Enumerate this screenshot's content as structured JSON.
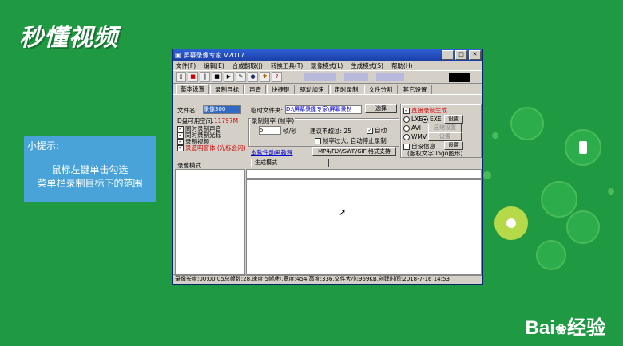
{
  "brand": {
    "logo": "秒懂视频",
    "footer_logo": "Bai",
    "footer_tail": "经验"
  },
  "tip": {
    "title": "小提示:",
    "line1": "鼠标左键单击勾选",
    "line2": "菜单栏录制目标下的范围"
  },
  "window": {
    "title": "屏幕录像专家 V2017",
    "menu": [
      "文件(F)",
      "编辑(E)",
      "合成翻取(J)",
      "转换工具(T)",
      "录像模式(L)",
      "生成模式(S)",
      "帮助(H)"
    ],
    "tabs": [
      "基本设置",
      "录制目标",
      "声音",
      "快捷键",
      "驱动加速",
      "定时录制",
      "文件分割",
      "其它设置"
    ],
    "basic": {
      "filename_label": "文件名:",
      "filename_value": "录像300",
      "disk_free_label": "D盘可用空间:",
      "disk_free_value": "11797M",
      "checks": [
        "同时录制声音",
        "同时录制光标",
        "录制视频",
        "录造明窗体 (光标会闪)"
      ],
      "temp_folder_label": "临时文件夹:",
      "temp_folder_value": "D:\\屏幕录像专家\\屏幕录制",
      "choose_button": "选择",
      "fps_group": "录制频率 (帧率)",
      "fps_value": "5",
      "fps_unit": "帧/秒",
      "advice_label": "建议不超过: 25",
      "auto_label": "自动",
      "frame_too_big": "帧率过大, 自动停止录制",
      "tutorial_link": "本软件动画教程",
      "format_label": "MP4/FLV/SWF/GIF  格式支持",
      "direct_gen": "直接录制生成",
      "lxe_label": "LXE",
      "exe_label": "EXE",
      "settings_btn": "设置",
      "avi_label": "AVI",
      "compress_btn": "压缩设置",
      "wmv_label": "WMV",
      "settings_btn2": "设置",
      "auto_info": "自设信息",
      "settings_btn3": "设置",
      "copyright_text": "(版权文字 logo图形)"
    },
    "left_panel_header": "录像模式",
    "right_panel_header": "生成模式",
    "status": "录像长度:00:00:05总帧数:28,速度:5帧/秒,宽度:454,高度:336,文件大小:969KB,创建时间:2018-7-16 14:53"
  }
}
